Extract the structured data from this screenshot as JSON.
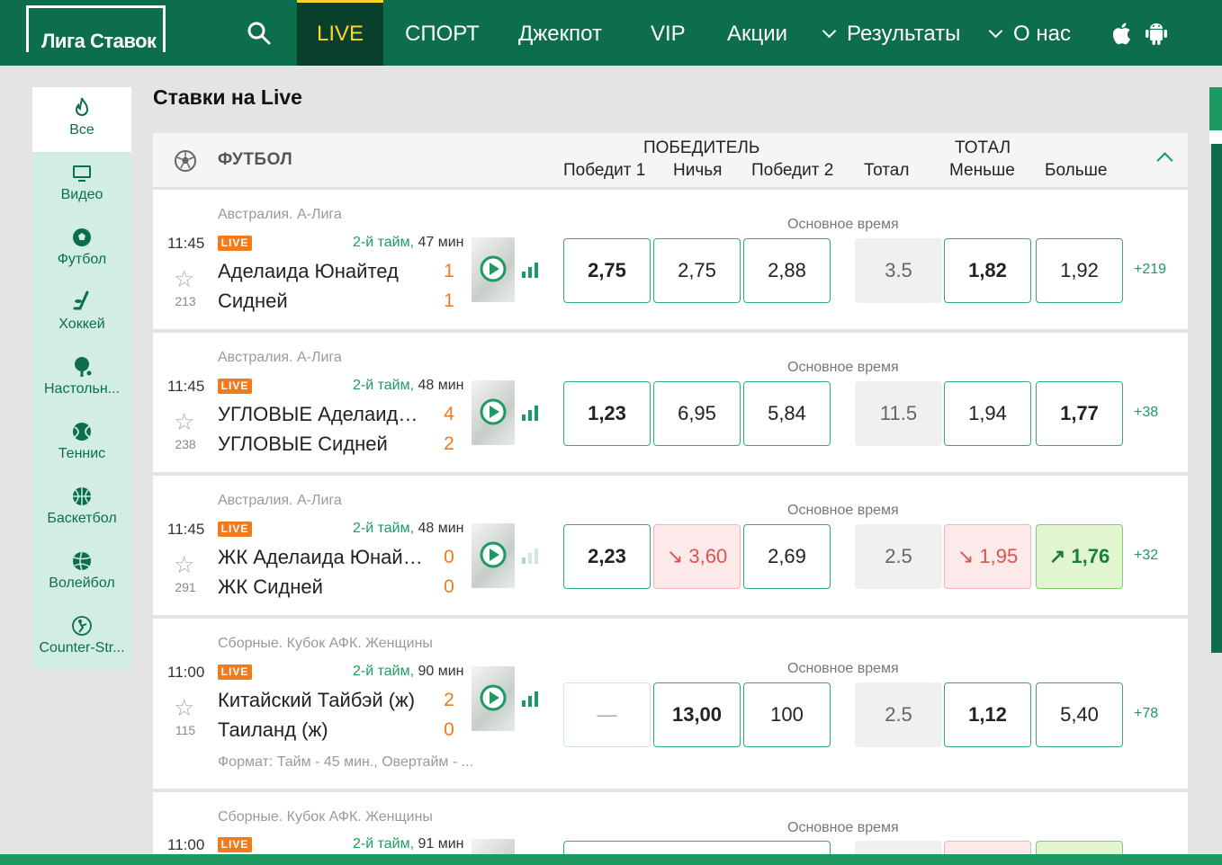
{
  "brand": {
    "logo_text": "Лига Ставок"
  },
  "nav": {
    "items": [
      "LIVE",
      "СПОРТ",
      "Джекпот",
      "VIP",
      "Акции",
      "Результаты",
      "О нас"
    ]
  },
  "sidebar": {
    "items": [
      {
        "label": "Все",
        "icon": "flame-icon"
      },
      {
        "label": "Видео",
        "icon": "tv-icon"
      },
      {
        "label": "Футбол",
        "icon": "soccer-ball-icon"
      },
      {
        "label": "Хоккей",
        "icon": "hockey-icon"
      },
      {
        "label": "Настольн...",
        "icon": "table-tennis-icon"
      },
      {
        "label": "Теннис",
        "icon": "tennis-ball-icon"
      },
      {
        "label": "Баскетбол",
        "icon": "basketball-icon"
      },
      {
        "label": "Волейбол",
        "icon": "volleyball-icon"
      },
      {
        "label": "Counter-Str...",
        "icon": "counter-strike-icon"
      }
    ]
  },
  "page_title": "Ставки на Live",
  "table_header": {
    "sport": "ФУТБОЛ",
    "winner_group": "ПОБЕДИТЕЛЬ",
    "total_group": "ТОТАЛ",
    "cols": [
      "Победит 1",
      "Ничья",
      "Победит 2",
      "Тотал",
      "Меньше",
      "Больше"
    ]
  },
  "live_label": "LIVE",
  "main_time_label": "Основное время",
  "matches": [
    {
      "league": "Австралия. А-Лига",
      "time": "11:45",
      "period": "2-й тайм,",
      "minutes": "47 мин",
      "fav": "213",
      "team1": "Аделаида Юнайтед",
      "team2": "Сидней",
      "score1": "1",
      "score2": "1",
      "odds": [
        "2,75",
        "2,75",
        "2,88",
        "3.5",
        "1,82",
        "1,92"
      ],
      "more": "+219"
    },
    {
      "league": "Австралия. А-Лига",
      "time": "11:45",
      "period": "2-й тайм,",
      "minutes": "48 мин",
      "fav": "238",
      "team1": "УГЛОВЫЕ Аделаида Юнайтед",
      "team2": "УГЛОВЫЕ Сидней",
      "score1": "4",
      "score2": "2",
      "odds": [
        "1,23",
        "6,95",
        "5,84",
        "11.5",
        "1,94",
        "1,77"
      ],
      "more": "+38"
    },
    {
      "league": "Австралия. А-Лига",
      "time": "11:45",
      "period": "2-й тайм,",
      "minutes": "48 мин",
      "fav": "291",
      "team1": "ЖК Аделаида Юнайтед",
      "team2": "ЖК Сидней",
      "score1": "0",
      "score2": "0",
      "odds": [
        "2,23",
        "↘ 3,60",
        "2,69",
        "2.5",
        "↘ 1,95",
        "↗ 1,76"
      ],
      "more": "+32"
    },
    {
      "league": "Сборные. Кубок АФК. Женщины",
      "time": "11:00",
      "period": "2-й тайм,",
      "minutes": "90 мин",
      "fav": "115",
      "team1": "Китайский Тайбэй (ж)",
      "team2": "Таиланд (ж)",
      "score1": "2",
      "score2": "0",
      "odds": [
        "—",
        "13,00",
        "100",
        "2.5",
        "1,12",
        "5,40"
      ],
      "more": "+78",
      "format": "Формат: Тайм - 45 мин., Овертайм - ..."
    },
    {
      "league": "Сборные. Кубок АФК. Женщины",
      "time": "11:00",
      "period": "2-й тайм,",
      "minutes": "91 мин"
    }
  ],
  "colors": {
    "brand_green": "#0d6e4b",
    "accent_green": "#1d9a62",
    "live_yellow": "#ffd52a",
    "live_orange": "#f07a1c"
  }
}
